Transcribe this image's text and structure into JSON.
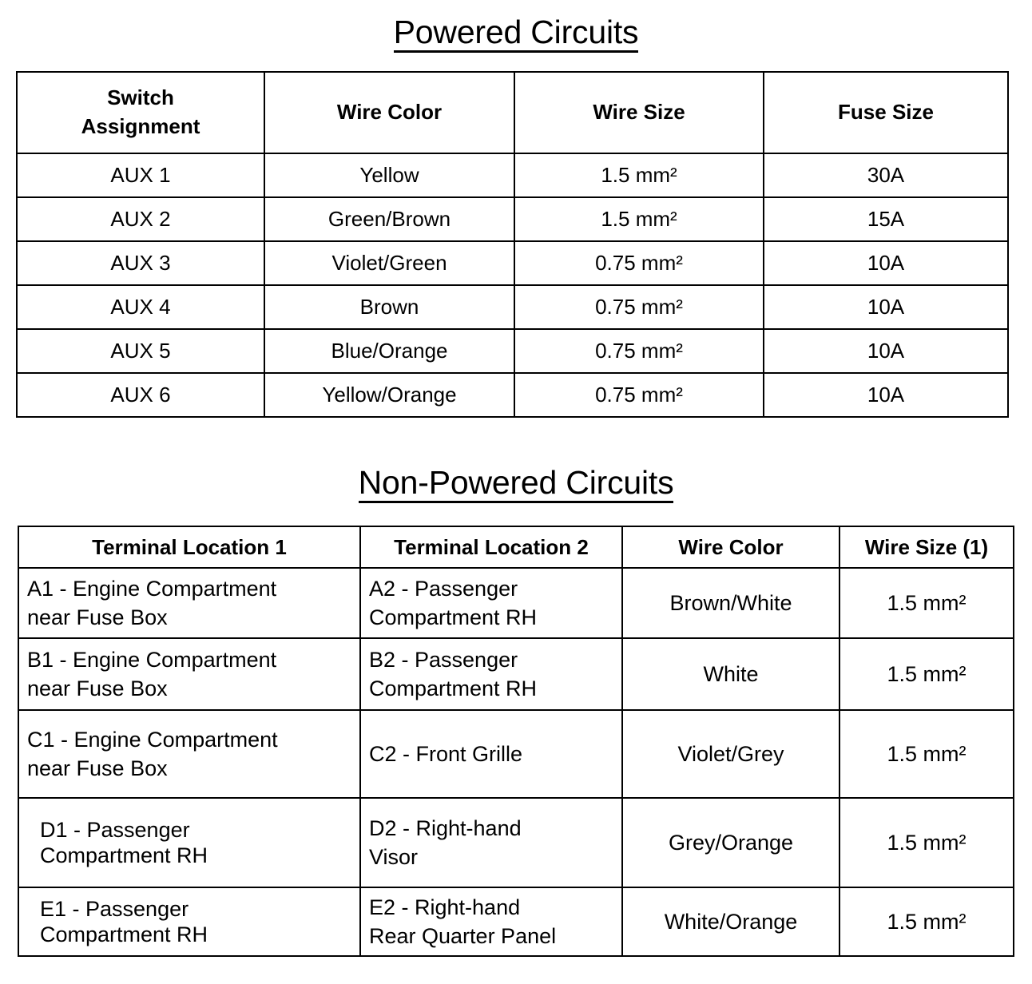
{
  "sections": [
    {
      "title": "Powered Circuits",
      "table": {
        "headers": [
          "Switch\nAssignment",
          "Wire Color",
          "Wire Size",
          "Fuse Size"
        ],
        "header_line1": "Switch",
        "header_line2": "Assignment",
        "rows": [
          {
            "switch_assignment": "AUX 1",
            "wire_color": "Yellow",
            "wire_size": "1.5 mm²",
            "fuse_size": "30A"
          },
          {
            "switch_assignment": "AUX 2",
            "wire_color": "Green/Brown",
            "wire_size": "1.5 mm²",
            "fuse_size": "15A"
          },
          {
            "switch_assignment": "AUX 3",
            "wire_color": "Violet/Green",
            "wire_size": "0.75 mm²",
            "fuse_size": "10A"
          },
          {
            "switch_assignment": "AUX 4",
            "wire_color": "Brown",
            "wire_size": "0.75 mm²",
            "fuse_size": "10A"
          },
          {
            "switch_assignment": "AUX 5",
            "wire_color": "Blue/Orange",
            "wire_size": "0.75 mm²",
            "fuse_size": "10A"
          },
          {
            "switch_assignment": "AUX 6",
            "wire_color": "Yellow/Orange",
            "wire_size": "0.75 mm²",
            "fuse_size": "10A"
          }
        ]
      }
    },
    {
      "title": "Non-Powered Circuits",
      "table": {
        "headers": [
          "Terminal Location 1",
          "Terminal Location 2",
          "Wire Color",
          "Wire Size (1)"
        ],
        "rows": [
          {
            "terminal_location_1_line1": "A1 - Engine Compartment",
            "terminal_location_1_line2": "near Fuse Box",
            "terminal_location_2_line1": "A2 - Passenger",
            "terminal_location_2_line2": "Compartment RH",
            "wire_color": "Brown/White",
            "wire_size": "1.5 mm²"
          },
          {
            "terminal_location_1_line1": "B1 - Engine Compartment",
            "terminal_location_1_line2": "near Fuse Box",
            "terminal_location_2_line1": "B2 - Passenger",
            "terminal_location_2_line2": "Compartment RH",
            "wire_color": "White",
            "wire_size": "1.5 mm²"
          },
          {
            "terminal_location_1_line1": "C1 - Engine Compartment",
            "terminal_location_1_line2": "near Fuse Box",
            "terminal_location_2_line1": "C2 - Front Grille",
            "terminal_location_2_line2": "",
            "wire_color": "Violet/Grey",
            "wire_size": "1.5 mm²"
          },
          {
            "terminal_location_1_line1": "D1 - Passenger",
            "terminal_location_1_line2": "Compartment RH",
            "terminal_location_2_line1": "D2 - Right-hand",
            "terminal_location_2_line2": "Visor",
            "wire_color": "Grey/Orange",
            "wire_size": "1.5 mm²"
          },
          {
            "terminal_location_1_line1": "E1 - Passenger",
            "terminal_location_1_line2": "Compartment RH",
            "terminal_location_2_line1": "E2 - Right-hand",
            "terminal_location_2_line2": "Rear Quarter Panel",
            "wire_color": "White/Orange",
            "wire_size": "1.5 mm²"
          }
        ]
      }
    }
  ],
  "colors": {
    "text": "#000000",
    "border": "#000000",
    "background": "#ffffff"
  }
}
